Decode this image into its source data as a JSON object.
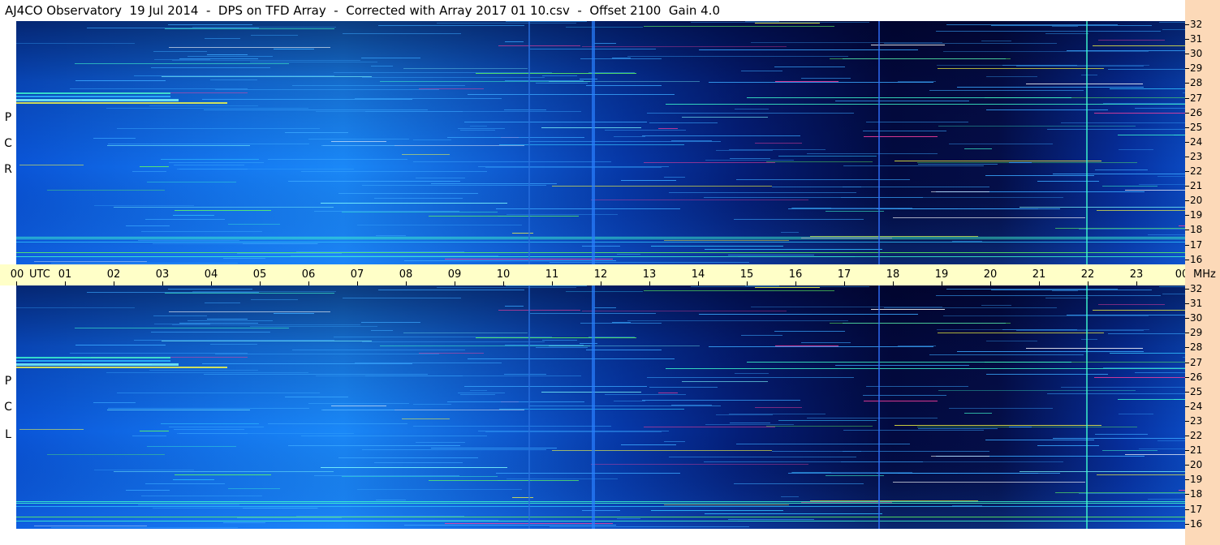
{
  "title": "AJ4CO Observatory  19 Jul 2014  -  DPS on TFD Array  -  Corrected with Array 2017 01 10.csv  -  Offset 2100  Gain 4.0",
  "colors": {
    "background": "#ffffff",
    "frequency_axis_bg": "#fcd9b8",
    "time_axis_bg": "#ffffc8",
    "spectrogram_low": "#000010",
    "spectrogram_mid": "#1060e0",
    "spectrogram_high": "#40ffd0",
    "rfi_peak": "#ff3090"
  },
  "chart_data": [
    {
      "type": "heatmap",
      "panel": "RCP",
      "side_label": [
        "R",
        "C",
        "P"
      ],
      "x_axis": {
        "label": "UTC",
        "range": [
          0,
          24
        ],
        "ticks": [
          "00",
          "01",
          "02",
          "03",
          "04",
          "05",
          "06",
          "07",
          "08",
          "09",
          "10",
          "11",
          "12",
          "13",
          "14",
          "15",
          "16",
          "17",
          "18",
          "19",
          "20",
          "21",
          "22",
          "23",
          "00"
        ]
      },
      "y_axis": {
        "label": "MHz",
        "range": [
          16,
          32
        ],
        "ticks": [
          "32",
          "31",
          "30",
          "29",
          "28",
          "27",
          "26",
          "25",
          "24",
          "23",
          "22",
          "21",
          "20",
          "19",
          "18",
          "17",
          "16"
        ]
      }
    },
    {
      "type": "heatmap",
      "panel": "LCP",
      "side_label": [
        "L",
        "C",
        "P"
      ],
      "x_axis": {
        "label": "UTC",
        "range": [
          0,
          24
        ],
        "ticks": [
          "00",
          "01",
          "02",
          "03",
          "04",
          "05",
          "06",
          "07",
          "08",
          "09",
          "10",
          "11",
          "12",
          "13",
          "14",
          "15",
          "16",
          "17",
          "18",
          "19",
          "20",
          "21",
          "22",
          "23",
          "00"
        ]
      },
      "y_axis": {
        "label": "MHz",
        "range": [
          16,
          32
        ],
        "ticks": [
          "32",
          "31",
          "30",
          "29",
          "28",
          "27",
          "26",
          "25",
          "24",
          "23",
          "22",
          "21",
          "20",
          "19",
          "18",
          "17",
          "16"
        ]
      }
    }
  ],
  "time_axis": {
    "unit_label": "UTC",
    "ticks": [
      "00",
      "01",
      "02",
      "03",
      "04",
      "05",
      "06",
      "07",
      "08",
      "09",
      "10",
      "11",
      "12",
      "13",
      "14",
      "15",
      "16",
      "17",
      "18",
      "19",
      "20",
      "21",
      "22",
      "23",
      "00"
    ]
  },
  "freq_axis": {
    "unit_label": "MHz",
    "ticks": [
      "32",
      "31",
      "30",
      "29",
      "28",
      "27",
      "26",
      "25",
      "24",
      "23",
      "22",
      "21",
      "20",
      "19",
      "18",
      "17",
      "16"
    ]
  }
}
